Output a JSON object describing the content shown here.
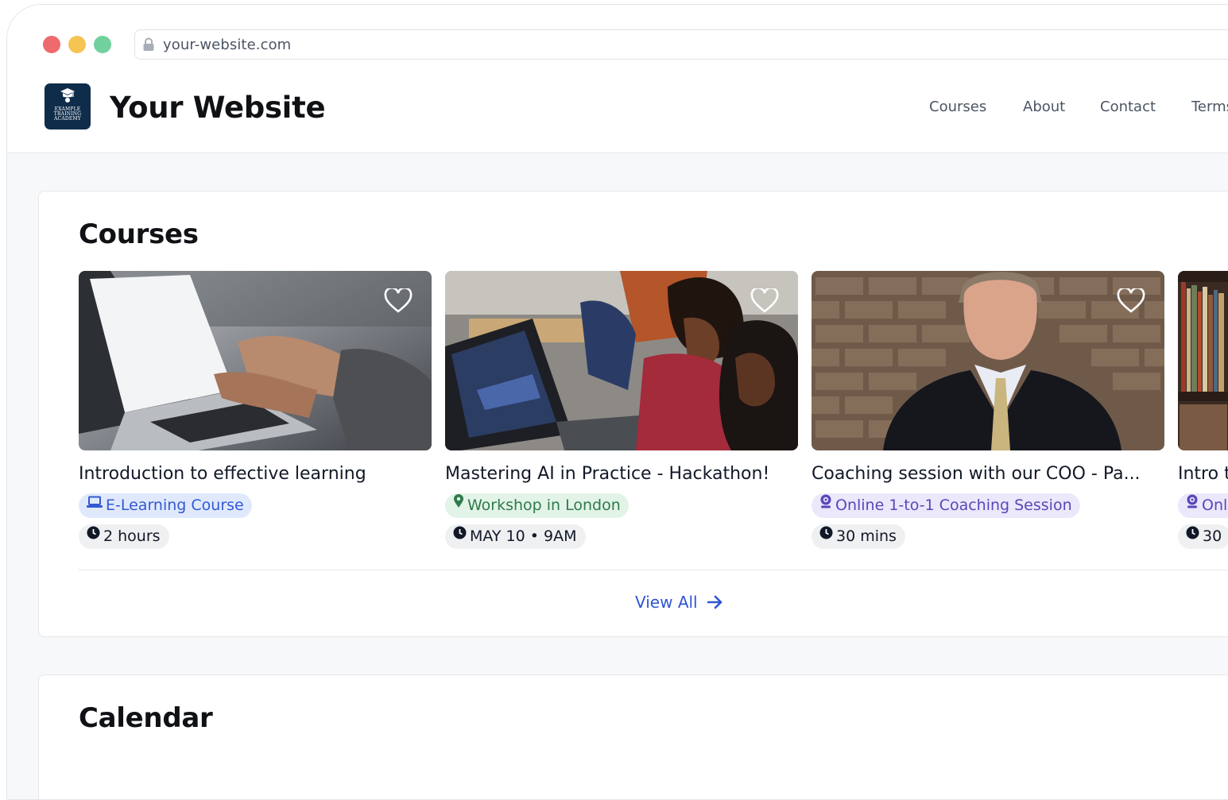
{
  "browser": {
    "url": "your-website.com",
    "traffic_lights": [
      "#ee6a6c",
      "#f6c453",
      "#71d19e"
    ]
  },
  "header": {
    "logo_text": [
      "EXAMPLE",
      "TRAINING",
      "ACADEMY"
    ],
    "site_name": "Your Website",
    "nav": [
      "Courses",
      "About",
      "Contact",
      "Terms"
    ]
  },
  "courses": {
    "title": "Courses",
    "cards": [
      {
        "title": "Introduction to effective learning",
        "type_label": "E-Learning Course",
        "type_icon": "laptop-icon",
        "time": "2 hours"
      },
      {
        "title": "Mastering AI in Practice - Hackathon!",
        "type_label": "Workshop in London",
        "type_icon": "map-pin-icon",
        "time": "MAY 10 • 9AM"
      },
      {
        "title": "Coaching session with our COO - Pa...",
        "type_label": "Online 1-to-1 Coaching Session",
        "type_icon": "webcam-icon",
        "time": "30 mins"
      },
      {
        "title": "Intro t",
        "type_label": "Onli",
        "type_icon": "webcam-icon",
        "time": "30"
      }
    ],
    "view_all": "View All"
  },
  "calendar": {
    "title": "Calendar"
  },
  "colors": {
    "accent": "#2f55d4",
    "logo_bg": "#0f2d4a",
    "pill_blue": "#e0e9fc",
    "pill_green": "#e2f3e8",
    "pill_purple": "#ebe8fb"
  }
}
